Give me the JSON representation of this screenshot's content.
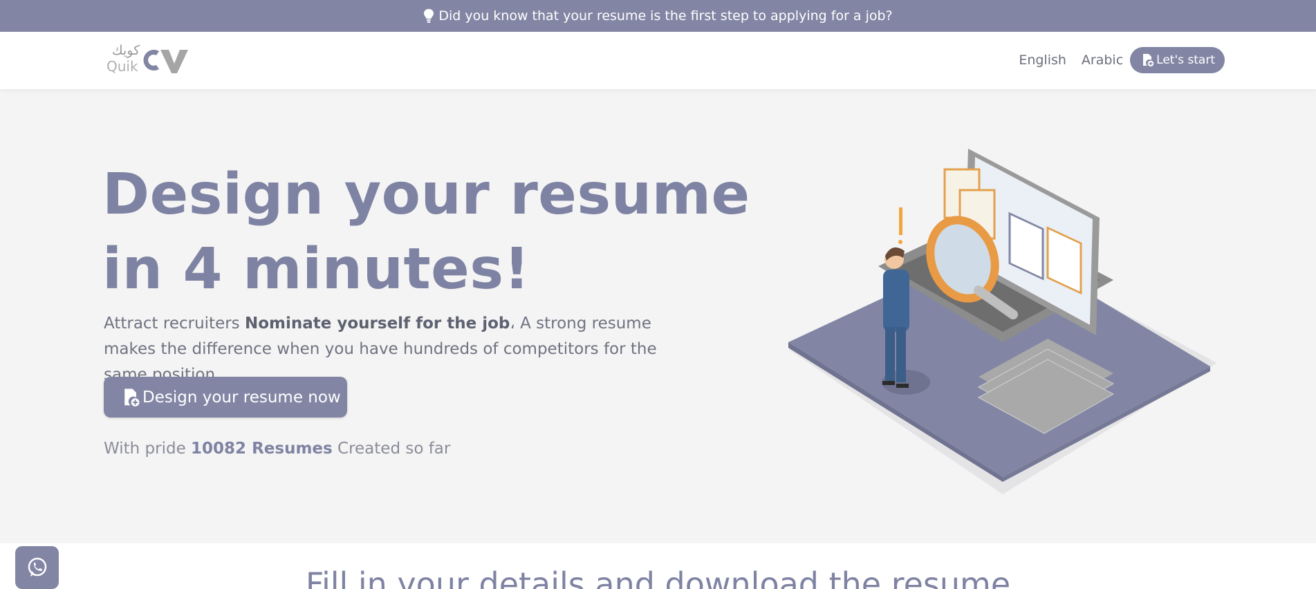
{
  "announcement": {
    "text": "Did you know that your resume is the first step to applying for a job?",
    "icon": "lightbulb-icon"
  },
  "brand": {
    "arabic": "كويك",
    "latin": "Quik",
    "mark": "CV",
    "color": "#8286a4"
  },
  "nav": {
    "links": [
      "English",
      "Arabic"
    ],
    "start_label": "Let's start"
  },
  "hero": {
    "title_line1": "Design your resume",
    "title_line2": "in 4 minutes!",
    "sub_prefix": "Attract recruiters ",
    "sub_bold": "Nominate yourself for the job",
    "sub_rest": "، A strong resume makes the difference when you have hundreds of competitors for the same position.",
    "cta_label": "Design your resume now",
    "pride_prefix": "With pride ",
    "pride_count": "10082 Resumes",
    "pride_suffix": " Created so far"
  },
  "section": {
    "heading": "Fill in your details and download the resume"
  },
  "colors": {
    "accent": "#8286a4",
    "title": "#7f83a3",
    "background": "#f4f4f4"
  }
}
